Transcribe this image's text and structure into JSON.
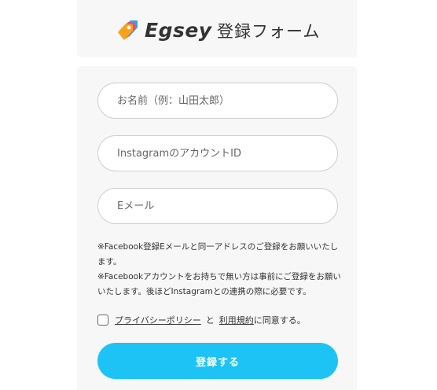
{
  "header": {
    "brand": "Egsey",
    "title": "登録フォーム"
  },
  "form": {
    "name_placeholder": "お名前（例：山田太郎）",
    "instagram_placeholder": "InstagramのアカウントID",
    "email_placeholder": "Eメール",
    "note_1": "※Facebook登録Eメールと同一アドレスのご登録をお願いいたします。",
    "note_2": "※Facebookアカウントをお持ちで無い方は事前にご登録をお願いいたします。後ほどInstagramとの連携の際に必要です。",
    "privacy_link": "プライバシーポリシー",
    "and_text": "と",
    "terms_link": "利用規約",
    "agree_suffix": "に同意する。",
    "submit_label": "登録する"
  },
  "colors": {
    "accent": "#1ec3f6",
    "logo_orange": "#f7a21b",
    "logo_pink": "#ef4b7a",
    "logo_blue": "#2aa8e0"
  },
  "icons": {
    "logo": "tag-logo-icon",
    "checkbox": "checkbox-unchecked-icon"
  }
}
